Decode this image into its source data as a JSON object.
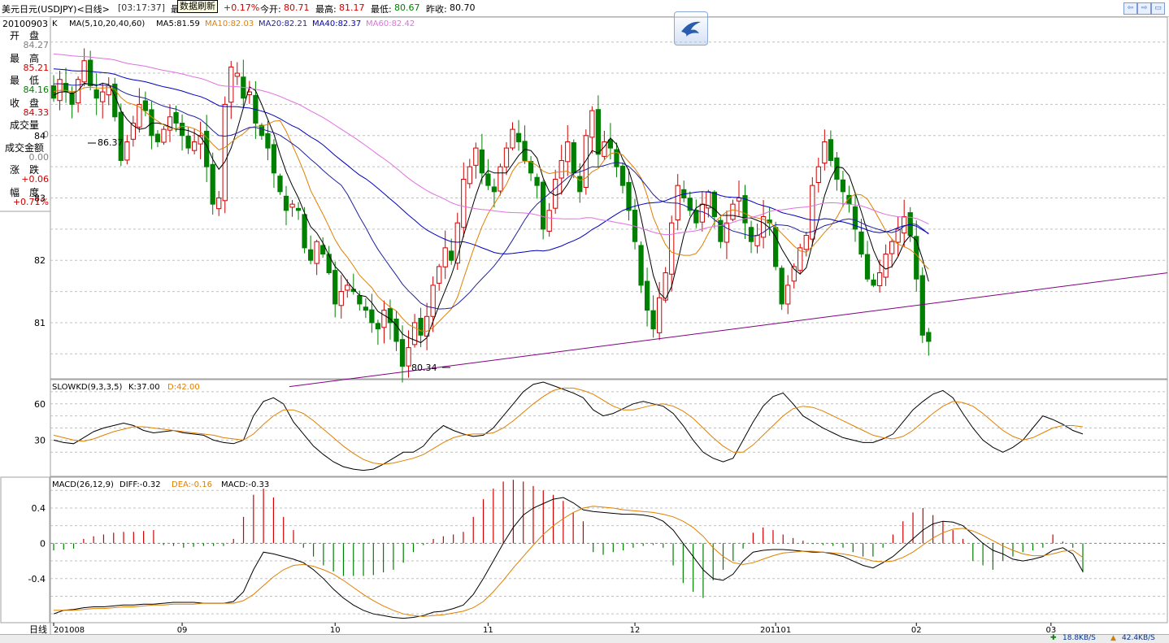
{
  "header": {
    "symbol": "美元日元(USDJPY)<日线>",
    "time": "[03:17:37]",
    "tooltip": "数据刷新",
    "change_pct": "+0.17%",
    "open_label": "今开:",
    "open": "80.71",
    "high_label": "最高:",
    "high": "81.17",
    "low_label": "最低:",
    "low": "80.67",
    "prev_label": "昨收:",
    "prev": "80.70",
    "partial_label": "最"
  },
  "window_buttons": [
    "⇦",
    "⇨",
    "▭"
  ],
  "info_panel": {
    "date": "20100903",
    "rows": [
      {
        "label": "开　盘",
        "value": "84.27",
        "color": "#808080"
      },
      {
        "label": "最　高",
        "value": "85.21",
        "color": "#d00000"
      },
      {
        "label": "最　低",
        "value": "84.16",
        "color": "#008000"
      },
      {
        "label": "收　盘",
        "value": "84.33",
        "color": "#d00000"
      },
      {
        "label": "成交量",
        "value": "0",
        "color": "#808080"
      },
      {
        "label": "成交金额",
        "value": "0.00",
        "color": "#808080"
      },
      {
        "label": "涨　跌",
        "value": "+0.06",
        "color": "#d00000"
      },
      {
        "label": "幅　度",
        "value": "+0.71%",
        "color": "#d00000"
      }
    ]
  },
  "colors": {
    "up": "#d00000",
    "down": "#008000",
    "ma5": "#000000",
    "ma10": "#e08000",
    "ma20": "#2020a0",
    "ma40": "#0000c0",
    "ma60": "#e070e0",
    "trend": "#800080",
    "grid": "#c0c0c0",
    "k_line": "#000000",
    "d_line": "#e08000"
  },
  "chart_data": [
    {
      "type": "candlestick",
      "title": "K",
      "legend": {
        "ma_label": "MA(5,10,20,40,60)",
        "ma5": "MA5:81.59",
        "ma10": "MA10:82.03",
        "ma20": "MA20:82.21",
        "ma40": "MA40:82.37",
        "ma60": "MA60:82.42"
      },
      "y_ticks": [
        "84",
        "83",
        "82",
        "81"
      ],
      "y_tick_values": [
        84,
        83,
        82,
        81
      ],
      "ylim": [
        80.1,
        85.9
      ],
      "annotations": {
        "max": "86.37",
        "min": "80.34"
      },
      "trendline": {
        "start": [
          0,
          80.0
        ],
        "end": [
          140,
          81.8
        ]
      },
      "closes": [
        84.6,
        84.9,
        84.7,
        84.5,
        84.9,
        85.2,
        84.8,
        84.6,
        84.7,
        84.8,
        84.3,
        83.6,
        83.9,
        84.2,
        84.5,
        84.4,
        84.0,
        83.9,
        84.1,
        84.3,
        84.2,
        84.0,
        83.8,
        83.9,
        84.0,
        83.5,
        82.9,
        83.0,
        84.5,
        85.1,
        85.0,
        84.6,
        84.7,
        84.2,
        84.0,
        83.8,
        83.4,
        83.1,
        82.8,
        82.9,
        82.8,
        82.2,
        82.0,
        82.3,
        82.1,
        81.8,
        81.3,
        81.5,
        81.6,
        81.5,
        81.3,
        81.2,
        81.0,
        80.9,
        81.2,
        81.0,
        80.7,
        80.3,
        80.6,
        81.0,
        80.8,
        81.1,
        81.6,
        81.9,
        82.2,
        82.0,
        82.6,
        83.3,
        83.5,
        83.8,
        83.4,
        83.2,
        83.1,
        83.5,
        83.8,
        84.1,
        83.9,
        83.6,
        83.4,
        83.2,
        82.5,
        82.8,
        83.3,
        83.6,
        83.9,
        83.4,
        83.1,
        84.0,
        84.4,
        83.7,
        83.9,
        83.8,
        83.5,
        83.2,
        82.8,
        82.3,
        81.6,
        81.2,
        80.9,
        81.4,
        81.8,
        82.6,
        83.2,
        83.0,
        82.8,
        82.6,
        82.9,
        83.1,
        82.7,
        82.3,
        82.6,
        82.9,
        83.0,
        82.6,
        82.3,
        82.4,
        82.7,
        82.6,
        81.9,
        81.3,
        81.6,
        81.9,
        82.2,
        82.4,
        83.2,
        83.5,
        83.9,
        83.6,
        83.3,
        83.1,
        82.9,
        82.5,
        82.1,
        81.7,
        81.6,
        81.8,
        82.1,
        82.3,
        82.5,
        82.7,
        82.4,
        81.7,
        80.8,
        80.7
      ]
    },
    {
      "type": "line",
      "title": "SLOWKD(9,3,3,5)",
      "legend": {
        "k": "K:37.00",
        "d": "D:42.00"
      },
      "y_ticks": [
        "60",
        "30"
      ],
      "y_tick_values": [
        60,
        30
      ],
      "ylim": [
        0,
        80
      ],
      "series": [
        {
          "name": "K",
          "values": [
            30,
            28,
            27,
            32,
            37,
            40,
            42,
            44,
            42,
            38,
            36,
            37,
            38,
            36,
            35,
            34,
            30,
            28,
            27,
            30,
            50,
            62,
            65,
            60,
            45,
            35,
            25,
            18,
            12,
            8,
            6,
            5,
            6,
            10,
            15,
            20,
            20,
            25,
            35,
            42,
            38,
            35,
            33,
            34,
            40,
            50,
            60,
            70,
            76,
            78,
            75,
            72,
            69,
            65,
            55,
            50,
            52,
            56,
            60,
            62,
            60,
            58,
            52,
            42,
            30,
            20,
            15,
            12,
            15,
            30,
            45,
            58,
            66,
            69,
            60,
            50,
            45,
            40,
            36,
            32,
            30,
            28,
            28,
            31,
            35,
            45,
            55,
            62,
            68,
            71,
            65,
            52,
            40,
            30,
            24,
            20,
            24,
            30,
            40,
            50,
            47,
            43,
            38,
            35
          ]
        },
        {
          "name": "D",
          "values": [
            34,
            32,
            30,
            29,
            31,
            34,
            37,
            39,
            41,
            41,
            40,
            39,
            38,
            37,
            36,
            35,
            34,
            32,
            31,
            30,
            35,
            43,
            50,
            55,
            55,
            52,
            46,
            39,
            32,
            25,
            19,
            14,
            11,
            10,
            11,
            13,
            15,
            18,
            23,
            28,
            32,
            34,
            35,
            35,
            36,
            40,
            46,
            53,
            60,
            66,
            71,
            73,
            73,
            71,
            68,
            63,
            58,
            55,
            55,
            57,
            59,
            60,
            58,
            54,
            48,
            40,
            32,
            25,
            20,
            20,
            26,
            34,
            42,
            50,
            56,
            58,
            57,
            54,
            50,
            46,
            42,
            38,
            34,
            32,
            31,
            33,
            38,
            45,
            52,
            58,
            62,
            61,
            58,
            52,
            45,
            38,
            33,
            30,
            32,
            36,
            40,
            42,
            42,
            41
          ]
        }
      ]
    },
    {
      "type": "bar",
      "title": "MACD(26,12,9)",
      "legend": {
        "diff": "DIFF:-0.32",
        "dea": "DEA:-0.16",
        "macd": "MACD:-0.33"
      },
      "y_ticks": [
        "0.4",
        "0",
        "-0.4"
      ],
      "y_tick_values": [
        0.4,
        0,
        -0.4
      ],
      "ylim": [
        -0.9,
        0.75
      ],
      "series": [
        {
          "name": "DIFF",
          "values": [
            -0.8,
            -0.76,
            -0.75,
            -0.73,
            -0.72,
            -0.72,
            -0.71,
            -0.7,
            -0.7,
            -0.69,
            -0.69,
            -0.68,
            -0.67,
            -0.67,
            -0.67,
            -0.68,
            -0.68,
            -0.68,
            -0.66,
            -0.55,
            -0.3,
            -0.1,
            -0.12,
            -0.15,
            -0.18,
            -0.22,
            -0.3,
            -0.4,
            -0.52,
            -0.62,
            -0.7,
            -0.76,
            -0.8,
            -0.82,
            -0.84,
            -0.85,
            -0.84,
            -0.82,
            -0.78,
            -0.77,
            -0.74,
            -0.7,
            -0.58,
            -0.4,
            -0.2,
            0.0,
            0.18,
            0.32,
            0.4,
            0.45,
            0.5,
            0.52,
            0.46,
            0.38,
            0.36,
            0.35,
            0.34,
            0.33,
            0.33,
            0.32,
            0.3,
            0.25,
            0.15,
            0.0,
            -0.15,
            -0.3,
            -0.4,
            -0.42,
            -0.35,
            -0.2,
            -0.1,
            -0.08,
            -0.07,
            -0.07,
            -0.08,
            -0.09,
            -0.1,
            -0.1,
            -0.12,
            -0.15,
            -0.2,
            -0.25,
            -0.28,
            -0.22,
            -0.15,
            -0.05,
            0.05,
            0.15,
            0.22,
            0.25,
            0.24,
            0.2,
            0.1,
            0.0,
            -0.08,
            -0.12,
            -0.18,
            -0.2,
            -0.18,
            -0.15,
            -0.08,
            -0.05,
            -0.12,
            -0.32
          ]
        },
        {
          "name": "DEA",
          "values": [
            -0.76,
            -0.76,
            -0.76,
            -0.75,
            -0.74,
            -0.74,
            -0.73,
            -0.72,
            -0.72,
            -0.71,
            -0.7,
            -0.7,
            -0.69,
            -0.69,
            -0.69,
            -0.68,
            -0.68,
            -0.68,
            -0.68,
            -0.65,
            -0.58,
            -0.48,
            -0.38,
            -0.3,
            -0.25,
            -0.24,
            -0.26,
            -0.3,
            -0.35,
            -0.42,
            -0.5,
            -0.58,
            -0.65,
            -0.71,
            -0.76,
            -0.8,
            -0.82,
            -0.83,
            -0.82,
            -0.81,
            -0.79,
            -0.77,
            -0.73,
            -0.66,
            -0.55,
            -0.42,
            -0.28,
            -0.15,
            -0.02,
            0.1,
            0.2,
            0.28,
            0.35,
            0.4,
            0.42,
            0.41,
            0.4,
            0.38,
            0.37,
            0.36,
            0.35,
            0.33,
            0.3,
            0.25,
            0.18,
            0.08,
            -0.05,
            -0.15,
            -0.22,
            -0.24,
            -0.22,
            -0.18,
            -0.14,
            -0.11,
            -0.1,
            -0.09,
            -0.09,
            -0.1,
            -0.11,
            -0.12,
            -0.14,
            -0.17,
            -0.2,
            -0.21,
            -0.2,
            -0.16,
            -0.1,
            -0.02,
            0.06,
            0.12,
            0.16,
            0.17,
            0.14,
            0.09,
            0.03,
            -0.03,
            -0.08,
            -0.12,
            -0.14,
            -0.14,
            -0.12,
            -0.09,
            -0.08,
            -0.16
          ]
        },
        {
          "name": "MACD",
          "values": [
            -0.08,
            -0.07,
            -0.06,
            0.05,
            0.08,
            0.1,
            0.12,
            0.13,
            0.13,
            0.14,
            0.15,
            -0.02,
            -0.03,
            -0.05,
            -0.04,
            -0.03,
            -0.03,
            -0.03,
            0.05,
            0.3,
            0.55,
            0.62,
            0.52,
            0.3,
            0.15,
            -0.05,
            -0.15,
            -0.25,
            -0.32,
            -0.37,
            -0.37,
            -0.37,
            -0.36,
            -0.33,
            -0.3,
            -0.22,
            -0.1,
            -0.02,
            0.05,
            0.08,
            0.1,
            0.13,
            0.3,
            0.5,
            0.62,
            0.7,
            0.72,
            0.7,
            0.65,
            0.6,
            0.55,
            0.48,
            0.35,
            0.25,
            -0.1,
            -0.13,
            -0.1,
            -0.08,
            -0.05,
            -0.03,
            -0.02,
            -0.05,
            -0.25,
            -0.45,
            -0.55,
            -0.62,
            -0.42,
            -0.3,
            -0.2,
            -0.06,
            0.12,
            0.18,
            0.15,
            0.1,
            0.06,
            0.03,
            -0.01,
            -0.02,
            -0.03,
            -0.05,
            -0.1,
            -0.15,
            -0.15,
            -0.05,
            0.1,
            0.25,
            0.35,
            0.4,
            0.32,
            0.25,
            0.15,
            0.05,
            -0.2,
            -0.25,
            -0.3,
            -0.2,
            -0.15,
            -0.1,
            -0.08,
            -0.05,
            0.1,
            0.02,
            -0.05,
            -0.33
          ]
        }
      ]
    }
  ],
  "x_axis": {
    "label": "日线",
    "labels": [
      {
        "text": "201008",
        "index": 0
      },
      {
        "text": "09",
        "index": 21
      },
      {
        "text": "10",
        "index": 46
      },
      {
        "text": "11",
        "index": 71
      },
      {
        "text": "12",
        "index": 95
      },
      {
        "text": "201101",
        "index": 118
      },
      {
        "text": "02",
        "index": 141
      },
      {
        "text": "03",
        "index": 163
      }
    ]
  },
  "status": {
    "net_down": "18.8KB/S",
    "net_up": "42.4KB/S"
  }
}
